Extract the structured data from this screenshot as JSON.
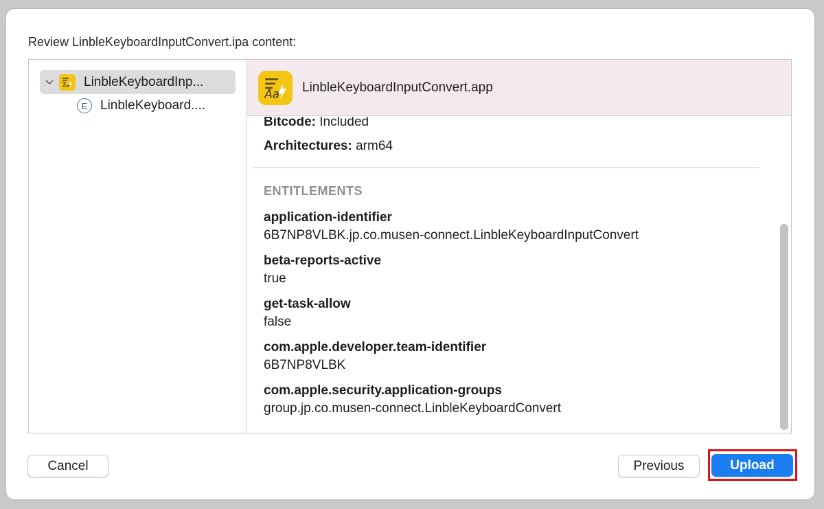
{
  "dialog": {
    "header": "Review LinbleKeyboardInputConvert.ipa content:"
  },
  "sidebar": {
    "items": [
      {
        "label": "LinbleKeyboardInp...",
        "icon": "app-icon",
        "expanded": true,
        "selected": true
      },
      {
        "label": "LinbleKeyboard....",
        "icon": "extension-icon",
        "badge": "E"
      }
    ]
  },
  "detail": {
    "title": "LinbleKeyboardInputConvert.app",
    "bitcode_label": "Bitcode:",
    "bitcode_value": "Included",
    "arch_label": "Architectures:",
    "arch_value": "arm64",
    "section_title": "ENTITLEMENTS",
    "entitlements": [
      {
        "key": "application-identifier",
        "value": "6B7NP8VLBK.jp.co.musen-connect.LinbleKeyboardInputConvert"
      },
      {
        "key": "beta-reports-active",
        "value": "true"
      },
      {
        "key": "get-task-allow",
        "value": "false"
      },
      {
        "key": "com.apple.developer.team-identifier",
        "value": "6B7NP8VLBK"
      },
      {
        "key": "com.apple.security.application-groups",
        "value": "group.jp.co.musen-connect.LinbleKeyboardConvert"
      }
    ]
  },
  "buttons": {
    "cancel": "Cancel",
    "previous": "Previous",
    "upload": "Upload"
  },
  "colors": {
    "accent": "#1a7ef0",
    "header_bg": "#f4e9ec",
    "app_icon": "#f3c615",
    "highlight": "#e0101a"
  }
}
